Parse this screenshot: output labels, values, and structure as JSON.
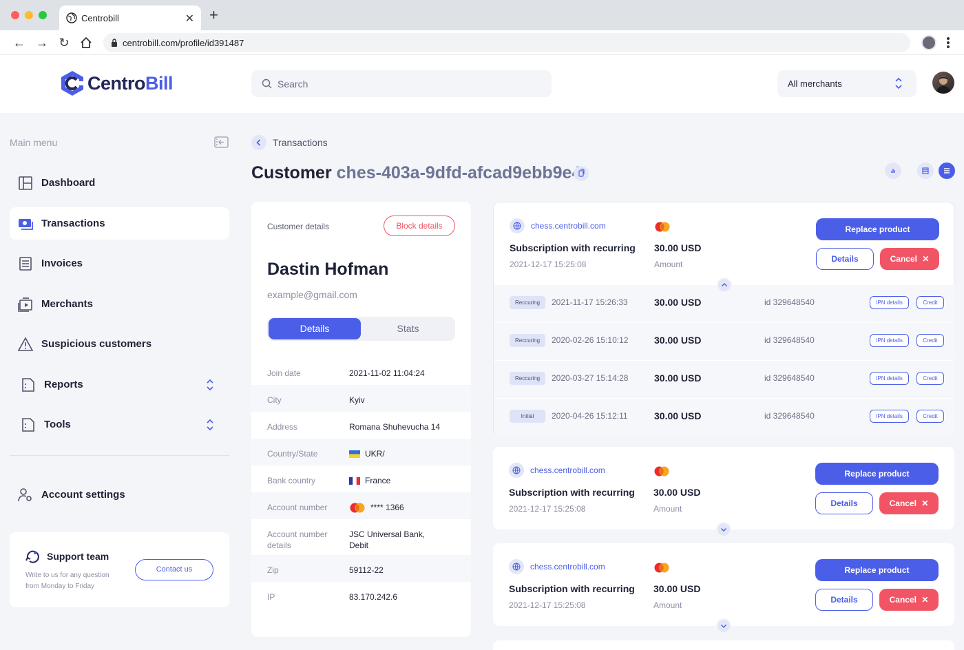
{
  "browser": {
    "tab_title": "Centrobill",
    "url": "centrobill.com/profile/id391487"
  },
  "header": {
    "logo_part1": "Centro",
    "logo_part2": "Bill",
    "search_placeholder": "Search",
    "merchant_select": "All merchants"
  },
  "sidebar": {
    "title": "Main menu",
    "items": [
      {
        "label": "Dashboard"
      },
      {
        "label": "Transactions"
      },
      {
        "label": "Invoices"
      },
      {
        "label": "Merchants"
      },
      {
        "label": "Suspicious customers"
      },
      {
        "label": "Reports"
      },
      {
        "label": "Tools"
      }
    ],
    "account_settings": "Account settings",
    "support": {
      "title": "Support team",
      "desc": "Write to us for any question from Monday to Friday",
      "button": "Contact us"
    }
  },
  "page": {
    "breadcrumb": "Transactions",
    "title_prefix": "Customer",
    "customer_id": "ches-403a-9dfd-afcad9ebb9e4"
  },
  "customer": {
    "section_label": "Customer details",
    "block_button": "Block details",
    "name": "Dastin Hofman",
    "email": "example@gmail.com",
    "tabs": [
      "Details",
      "Stats"
    ],
    "details": [
      {
        "key": "Join date",
        "value": "2021-11-02 11:04:24"
      },
      {
        "key": "City",
        "value": "Kyiv"
      },
      {
        "key": "Address",
        "value": "Romana Shuhevucha 14"
      },
      {
        "key": "Country/State",
        "value": "UKR/"
      },
      {
        "key": "Bank country",
        "value": "France"
      },
      {
        "key": "Account number",
        "value": "**** 1366"
      },
      {
        "key": "Account number details",
        "value": "JSC Universal Bank, Debit"
      },
      {
        "key": "Zip",
        "value": "59112-22"
      },
      {
        "key": "IP",
        "value": "83.170.242.6"
      }
    ]
  },
  "transactions": {
    "cards": [
      {
        "site": "chess.centrobill.com",
        "name": "Subscription with recurring",
        "date": "2021-12-17 15:25:08",
        "amount": "30.00 USD",
        "amount_label": "Amount",
        "replace": "Replace product",
        "details": "Details",
        "cancel": "Cancel",
        "expanded": true
      },
      {
        "site": "chess.centrobill.com",
        "name": "Subscription with recurring",
        "date": "2021-12-17 15:25:08",
        "amount": "30.00 USD",
        "amount_label": "Amount",
        "replace": "Replace product",
        "details": "Details",
        "cancel": "Cancel",
        "expanded": false
      },
      {
        "site": "chess.centrobill.com",
        "name": "Subscription with recurring",
        "date": "2021-12-17 15:25:08",
        "amount": "30.00 USD",
        "amount_label": "Amount",
        "replace": "Replace product",
        "details": "Details",
        "cancel": "Cancel",
        "expanded": false
      }
    ],
    "sub_rows": [
      {
        "badge": "Reccuring",
        "date": "2021-11-17 15:26:33",
        "amount": "30.00 USD",
        "id": "id 329648540",
        "ipn": "IPN details",
        "credit": "Credit"
      },
      {
        "badge": "Reccuring",
        "date": "2020-02-26 15:10:12",
        "amount": "30.00 USD",
        "id": "id 329648540",
        "ipn": "IPN details",
        "credit": "Credit"
      },
      {
        "badge": "Reccuring",
        "date": "2020-03-27 15:14:28",
        "amount": "30.00 USD",
        "id": "id 329648540",
        "ipn": "IPN details",
        "credit": "Credit"
      },
      {
        "badge": "Initial",
        "date": "2020-04-26 15:12:11",
        "amount": "30.00 USD",
        "id": "id 329648540",
        "ipn": "IPN details",
        "credit": "Credit"
      }
    ]
  },
  "colors": {
    "accent": "#4b5ee8",
    "danger": "#f15565",
    "navy": "#232759"
  },
  "icons": [
    "globe-icon",
    "close-icon",
    "plus-icon",
    "back-arrow-icon",
    "forward-arrow-icon",
    "reload-icon",
    "home-icon",
    "lock-icon",
    "kebab-icon",
    "search-icon",
    "chevron-updown-icon",
    "dashboard-icon",
    "transactions-icon",
    "invoices-icon",
    "merchants-icon",
    "warning-icon",
    "reports-icon",
    "tools-icon",
    "account-settings-icon",
    "support-icon",
    "copy-icon",
    "chart-icon",
    "grid-icon",
    "list-icon",
    "mastercard-icon"
  ]
}
